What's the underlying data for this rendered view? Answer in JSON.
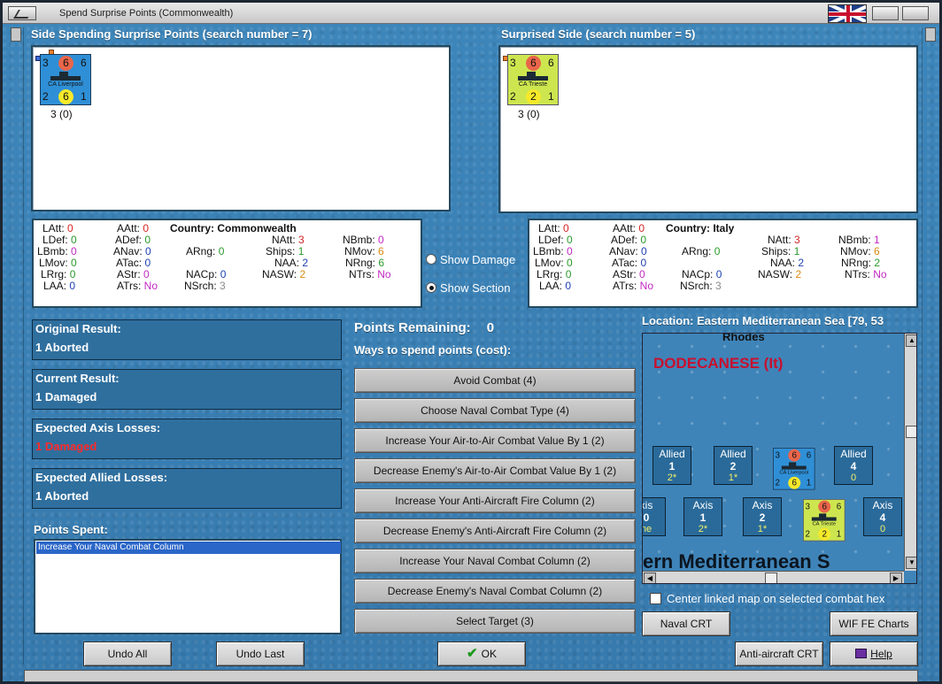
{
  "window": {
    "title": "Spend Surprise Points (Commonwealth)",
    "flag_icon": "union-jack-flag-icon"
  },
  "left_side": {
    "header": "Side Spending Surprise Points (search number = 7)",
    "counter": {
      "name": "CA Liverpool",
      "top_left": "3",
      "top_mid": "6",
      "top_right": "6",
      "bot_left": "2",
      "bot_mid": "6",
      "bot_right": "1",
      "under": "3 (0)",
      "color": "#2f8fd6",
      "top_circle_color": "#e9664a",
      "bot_circle_color": "#f5e92a"
    }
  },
  "right_side": {
    "header": "Surprised Side (search number = 5)",
    "counter": {
      "name": "CA Trieste",
      "top_left": "3",
      "top_mid": "6",
      "top_right": "6",
      "bot_left": "2",
      "bot_mid": "2",
      "bot_right": "1",
      "under": "3 (0)",
      "color": "#cde64f",
      "top_circle_color": "#e9664a",
      "bot_circle_color": "#f5e92a"
    }
  },
  "left_stats": {
    "country": "Country: Commonwealth",
    "LAtt": "0",
    "LDef": "0",
    "LBmb": "0",
    "LMov": "0",
    "LRrg": "0",
    "LAA": "0",
    "AAtt": "0",
    "ADef": "0",
    "ANav": "0",
    "ATac": "0",
    "AStr": "0",
    "ATrs": "No",
    "ARng": "0",
    "NACp": "0",
    "NSrch": "3",
    "NAtt": "3",
    "Ships": "1",
    "NAA": "2",
    "NASW": "2",
    "NBmb": "0",
    "NMov": "6",
    "NRng": "6",
    "NTrs": "No"
  },
  "right_stats": {
    "country": "Country: Italy",
    "LAtt": "0",
    "LDef": "0",
    "LBmb": "0",
    "LMov": "0",
    "LRrg": "0",
    "LAA": "0",
    "AAtt": "0",
    "ADef": "0",
    "ANav": "0",
    "ATac": "0",
    "AStr": "0",
    "ATrs": "No",
    "ARng": "0",
    "NACp": "0",
    "NSrch": "3",
    "NAtt": "3",
    "Ships": "1",
    "NAA": "2",
    "NASW": "2",
    "NBmb": "1",
    "NMov": "6",
    "NRng": "2",
    "NTrs": "No"
  },
  "options": {
    "show_damage": "Show Damage",
    "show_section": "Show Section",
    "selected": "show_section"
  },
  "results": {
    "original_label": "Original Result:",
    "original_value": "1 Aborted",
    "current_label": "Current Result:",
    "current_value": "1 Damaged",
    "axis_label": "Expected Axis Losses:",
    "axis_value": "1 Damaged",
    "allied_label": "Expected Allied Losses:",
    "allied_value": "1 Aborted"
  },
  "points_spent": {
    "label": "Points Spent:",
    "items": [
      "Increase Your Naval Combat Column"
    ]
  },
  "spend": {
    "remaining_label": "Points Remaining:",
    "remaining_value": "0",
    "ways_label": "Ways to spend points (cost):",
    "buttons": [
      "Avoid Combat (4)",
      "Choose Naval Combat Type (4)",
      "Increase Your Air-to-Air Combat Value By 1 (2)",
      "Decrease Enemy's Air-to-Air Combat Value By 1 (2)",
      "Increase Your Anti-Aircraft Fire Column (2)",
      "Decrease Enemy's Anti-Aircraft Fire Column (2)",
      "Increase Your Naval Combat Column (2)",
      "Decrease Enemy's Naval Combat Column (2)",
      "Select Target (3)"
    ]
  },
  "map": {
    "location": "Location: Eastern Mediterranean Sea [79, 53",
    "island": "Rhodes",
    "region": "DODECANESE (It)",
    "sea_name": "ern Mediterranean S",
    "allied_boxes": [
      {
        "a": "Allied",
        "b": "1",
        "c": "2*"
      },
      {
        "a": "Allied",
        "b": "2",
        "c": "1*"
      },
      {
        "a": "Allied",
        "b": "4",
        "c": "0"
      }
    ],
    "axis_boxes": [
      {
        "a": "xis",
        "b": "0",
        "c": "ne"
      },
      {
        "a": "Axis",
        "b": "1",
        "c": "2*"
      },
      {
        "a": "Axis",
        "b": "2",
        "c": "1*"
      },
      {
        "a": "Axis",
        "b": "4",
        "c": "0"
      }
    ],
    "center_linked": "Center linked map on selected combat hex"
  },
  "bottom_buttons": {
    "undo_all": "Undo All",
    "undo_last": "Undo Last",
    "ok": "OK",
    "naval_crt": "Naval CRT",
    "wif_fe_charts": "WIF FE Charts",
    "anti_aircraft_crt": "Anti-aircraft CRT",
    "help": "Help"
  }
}
